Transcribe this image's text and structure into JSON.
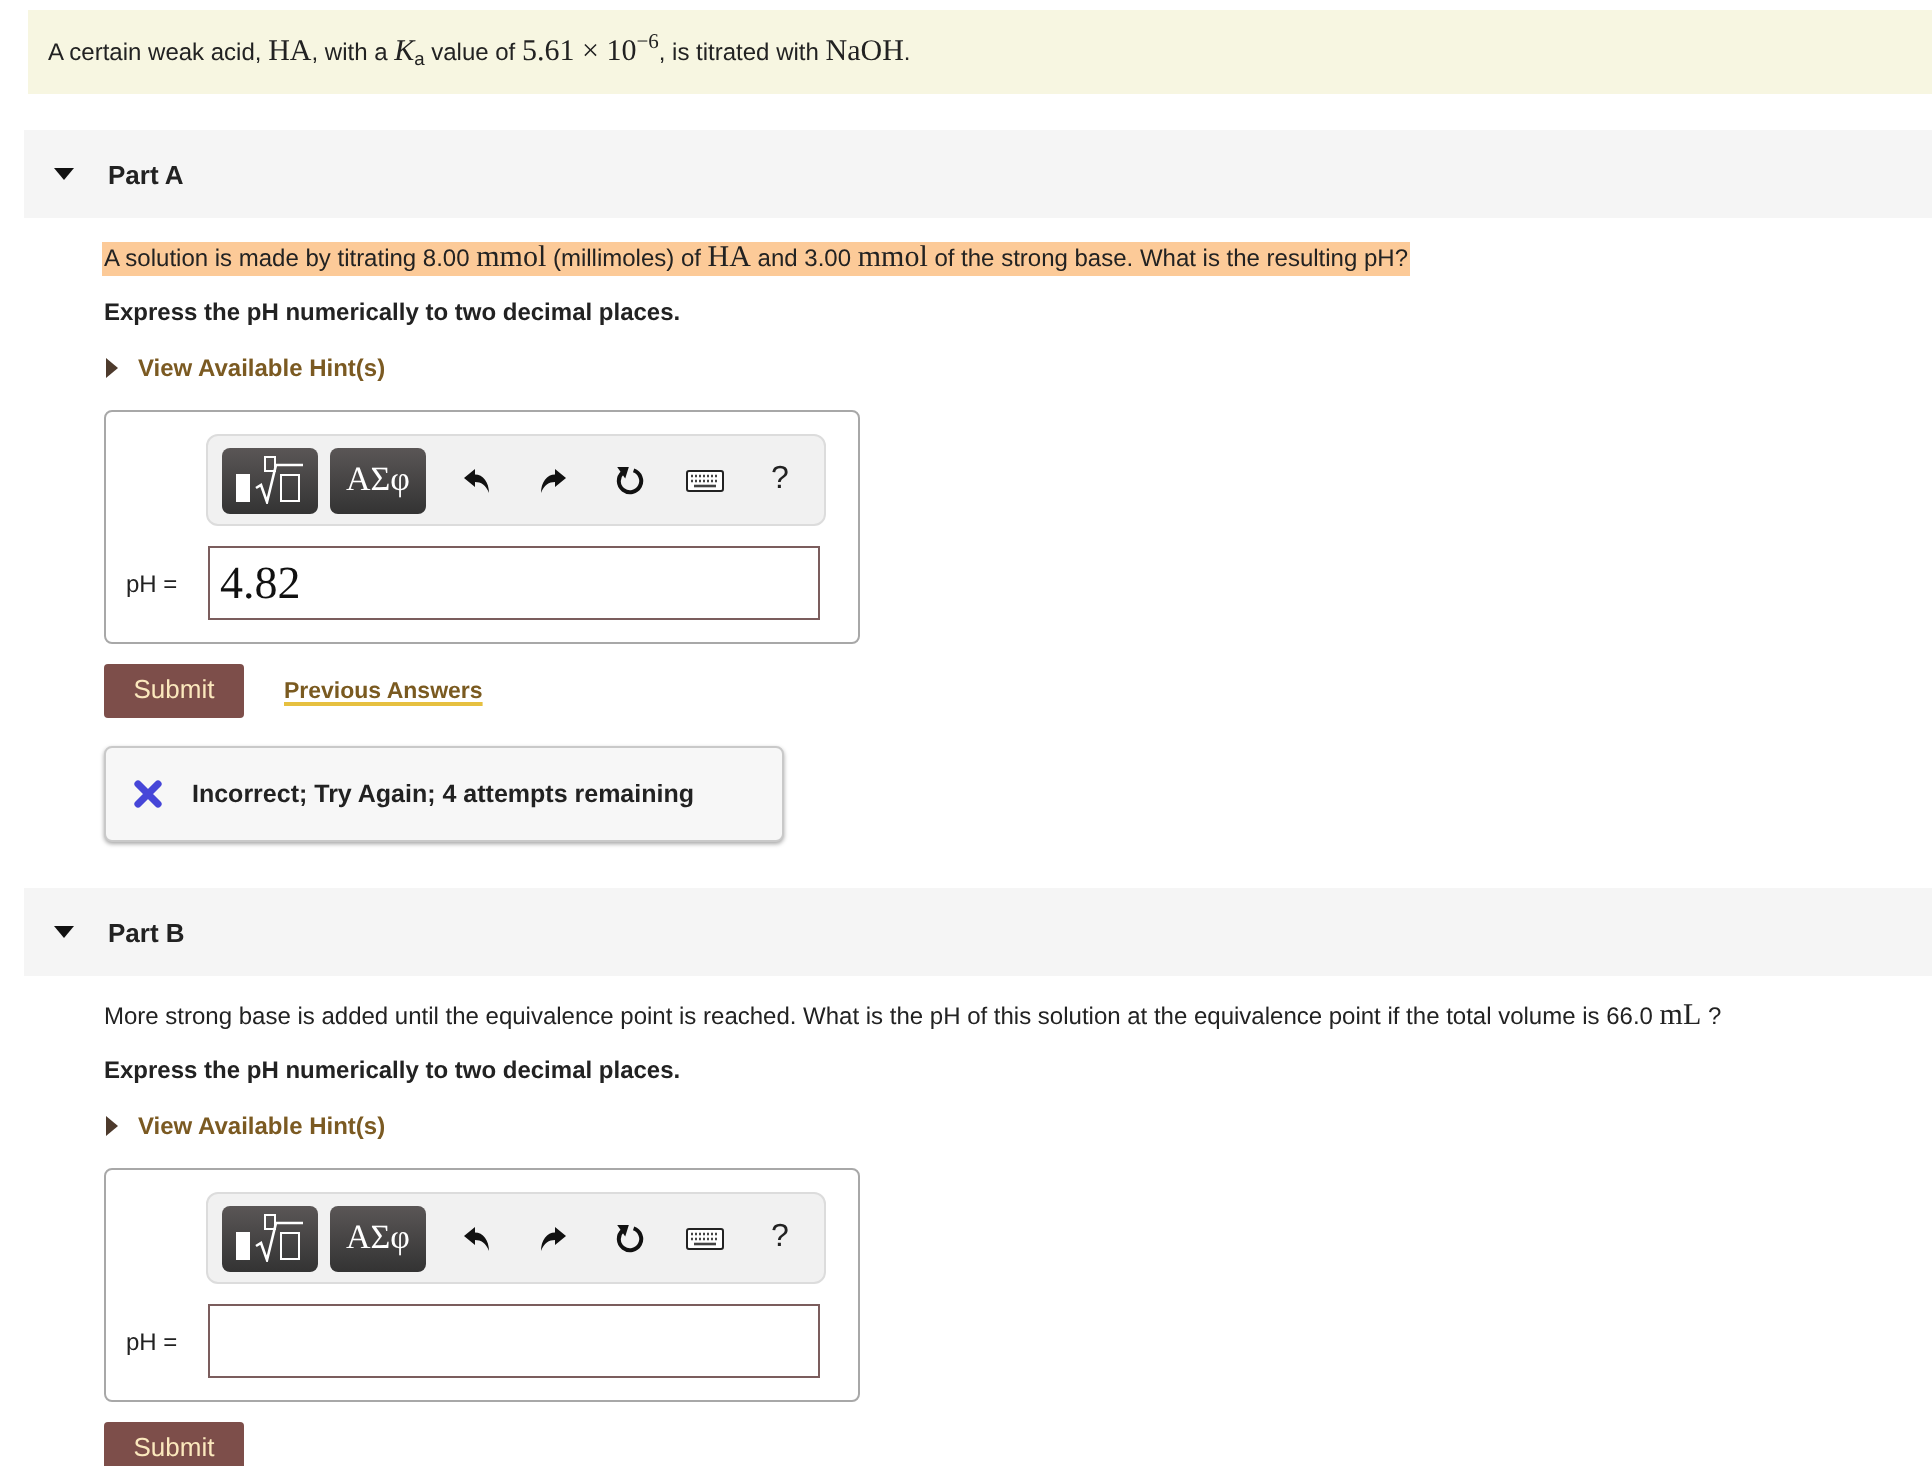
{
  "intro": {
    "segments": [
      {
        "kind": "text",
        "text": "A certain weak acid, "
      },
      {
        "kind": "math",
        "text": "HA"
      },
      {
        "kind": "text",
        "text": ", with a "
      },
      {
        "kind": "math",
        "text": "*K*$_{a}$"
      },
      {
        "kind": "text",
        "text": " value of "
      },
      {
        "kind": "math",
        "text": "5.61 × 10$^{−6}$"
      },
      {
        "kind": "text",
        "text": ", is titrated with "
      },
      {
        "kind": "math",
        "text": "NaOH"
      },
      {
        "kind": "text",
        "text": "."
      }
    ]
  },
  "parts": [
    {
      "title": "Part A",
      "expanded": true,
      "question": {
        "highlighted": true,
        "segments": [
          {
            "kind": "text",
            "text": "A solution is made by titrating 8.00 "
          },
          {
            "kind": "math",
            "text": "mmol"
          },
          {
            "kind": "text",
            "text": " (millimoles) of "
          },
          {
            "kind": "math",
            "text": "HA"
          },
          {
            "kind": "text",
            "text": " and 3.00 "
          },
          {
            "kind": "math",
            "text": "mmol"
          },
          {
            "kind": "text",
            "text": " of the strong base. What is the resulting pH?"
          }
        ]
      },
      "instruction": "Express the pH numerically to two decimal places.",
      "hint": {
        "label": "View Available Hint(s)",
        "expanded": false
      },
      "toolbar": {
        "symbols": "ΑΣφ",
        "help": "?"
      },
      "answer": {
        "label": "pH =",
        "value": "4.82"
      },
      "submit": "Submit",
      "previous_answers": "Previous Answers",
      "feedback": {
        "kind": "incorrect",
        "text": "Incorrect; Try Again; 4 attempts remaining"
      }
    },
    {
      "title": "Part B",
      "expanded": true,
      "question": {
        "highlighted": false,
        "segments": [
          {
            "kind": "text",
            "text": "More strong base is added until the equivalence point is reached. What is the pH of this solution at the equivalence point if the total volume is 66.0 "
          },
          {
            "kind": "math",
            "text": "mL"
          },
          {
            "kind": "text",
            "text": " ?"
          }
        ]
      },
      "instruction": "Express the pH numerically to two decimal places.",
      "hint": {
        "label": "View Available Hint(s)",
        "expanded": false
      },
      "toolbar": {
        "symbols": "ΑΣφ",
        "help": "?"
      },
      "answer": {
        "label": "pH ="
      },
      "submit": "Submit"
    }
  ]
}
